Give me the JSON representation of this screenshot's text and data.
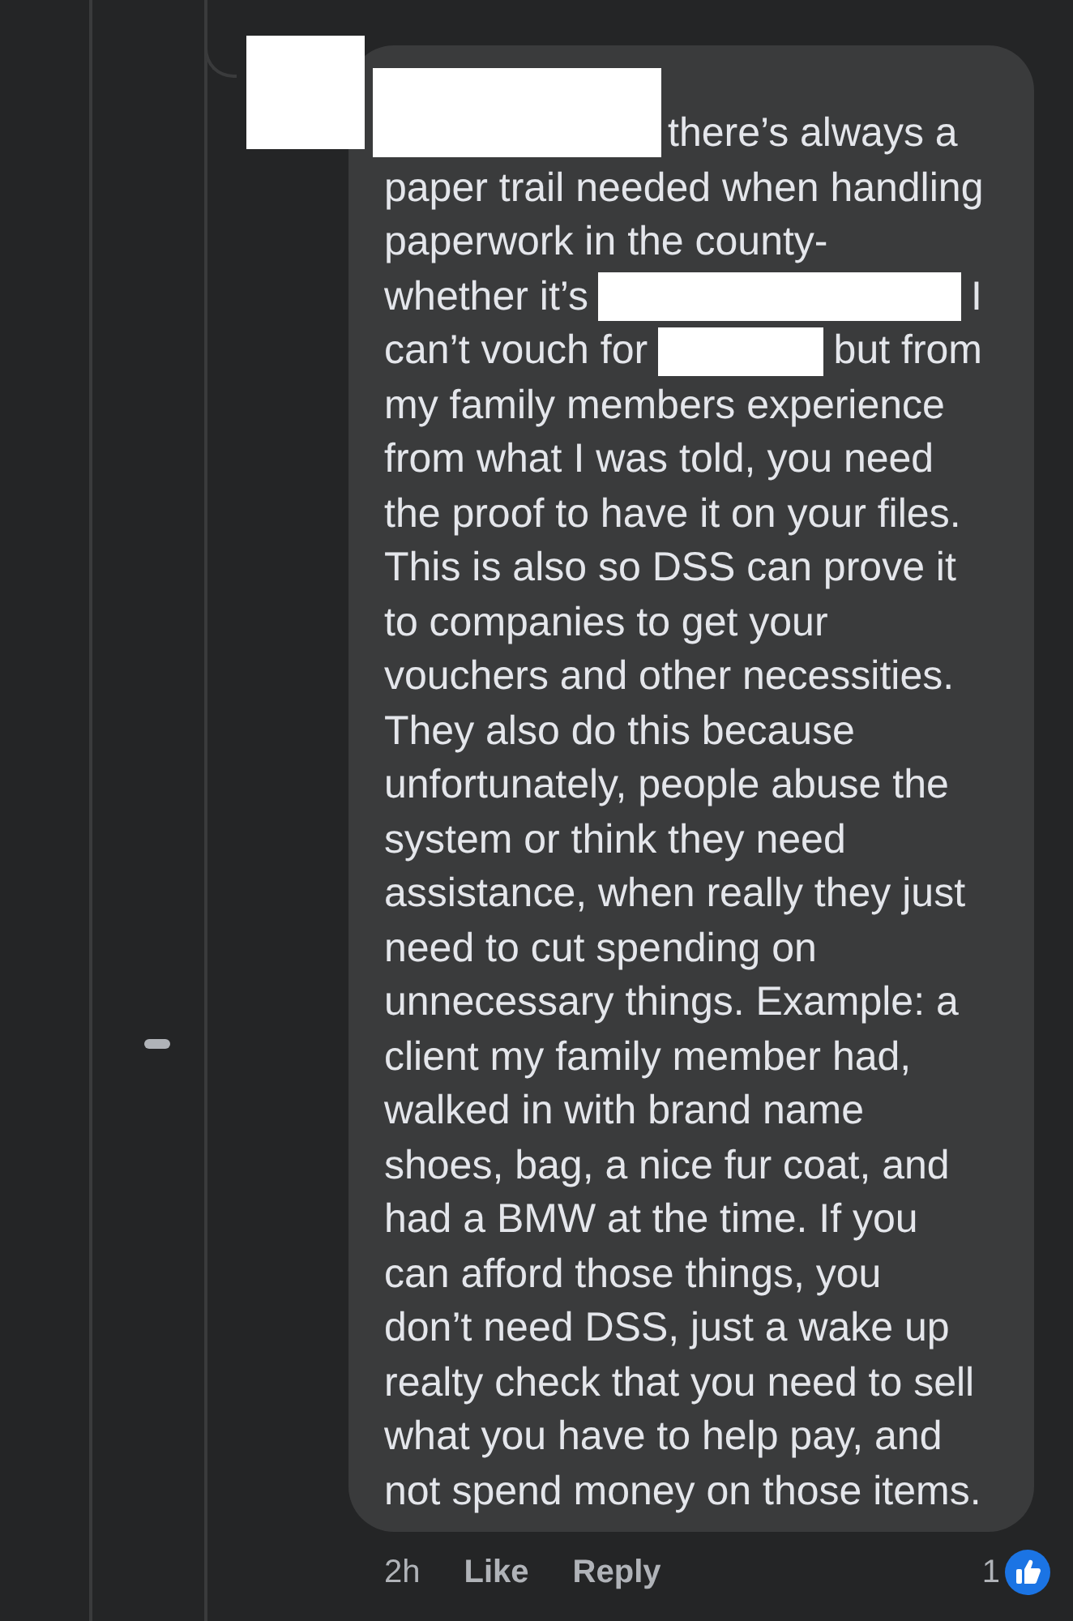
{
  "comment": {
    "avatar": {
      "kind": "redaction"
    },
    "lines": [
      [
        {
          "kind": "name"
        },
        {
          "kind": "text",
          "text": "there’s always a"
        }
      ],
      [
        {
          "kind": "text",
          "text": "paper trail needed when handling"
        }
      ],
      [
        {
          "kind": "text",
          "text": "paperwork in the county-"
        }
      ],
      [
        {
          "kind": "text",
          "text": "whether it’s"
        },
        {
          "kind": "redaction"
        },
        {
          "kind": "text",
          "text": "I"
        }
      ],
      [
        {
          "kind": "text",
          "text": "can’t vouch for"
        },
        {
          "kind": "redaction"
        },
        {
          "kind": "text",
          "text": "but from"
        }
      ],
      [
        {
          "kind": "text",
          "text": "my family members experience"
        }
      ],
      [
        {
          "kind": "text",
          "text": "from what I was told, you need"
        }
      ],
      [
        {
          "kind": "text",
          "text": "the proof to have it on your files."
        }
      ],
      [
        {
          "kind": "text",
          "text": "This is also so DSS can prove it"
        }
      ],
      [
        {
          "kind": "text",
          "text": "to companies to get your"
        }
      ],
      [
        {
          "kind": "text",
          "text": "vouchers and other necessities."
        }
      ],
      [
        {
          "kind": "text",
          "text": "They also do this because"
        }
      ],
      [
        {
          "kind": "text",
          "text": "unfortunately, people abuse the"
        }
      ],
      [
        {
          "kind": "text",
          "text": "system or think they need"
        }
      ],
      [
        {
          "kind": "text",
          "text": "assistance, when really they just"
        }
      ],
      [
        {
          "kind": "text",
          "text": "need to cut spending on"
        }
      ],
      [
        {
          "kind": "text",
          "text": "unnecessary things. Example: a"
        }
      ],
      [
        {
          "kind": "text",
          "text": "client my family member had,"
        }
      ],
      [
        {
          "kind": "text",
          "text": "walked in with brand name"
        }
      ],
      [
        {
          "kind": "text",
          "text": "shoes, bag, a nice fur coat, and"
        }
      ],
      [
        {
          "kind": "text",
          "text": "had a BMW at the time. If you"
        }
      ],
      [
        {
          "kind": "text",
          "text": "can afford those things, you"
        }
      ],
      [
        {
          "kind": "text",
          "text": "don’t need DSS, just a wake up"
        }
      ],
      [
        {
          "kind": "text",
          "text": "realty check that you need to sell"
        }
      ],
      [
        {
          "kind": "text",
          "text": "what you have to help pay, and"
        }
      ],
      [
        {
          "kind": "text",
          "text": "not spend money on those items."
        }
      ]
    ],
    "time": "2h",
    "actions": [
      "Like",
      "Reply"
    ],
    "reaction_count": "1"
  }
}
